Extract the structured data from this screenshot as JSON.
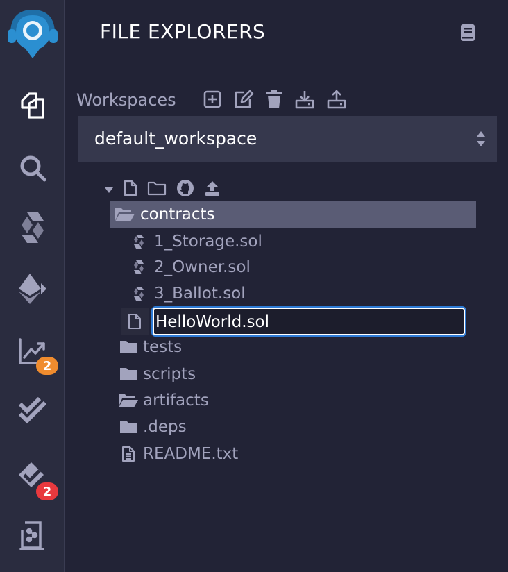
{
  "sidebar": {
    "icons": [
      "remix-logo-icon",
      "file-explorer-icon",
      "search-icon",
      "solidity-compiler-icon",
      "deploy-run-icon",
      "analysis-icon",
      "unit-testing-icon",
      "static-analysis-icon",
      "plugin-manager-icon"
    ],
    "analysis_badge": "2",
    "static_badge": "2",
    "colors": {
      "orange_badge": "#f08c2e",
      "red_badge": "#e8393e"
    }
  },
  "header": {
    "title": "FILE EXPLORERS"
  },
  "workspaces": {
    "label": "Workspaces",
    "selected": "default_workspace"
  },
  "tree": {
    "contracts_label": "contracts",
    "files": [
      "1_Storage.sol",
      "2_Owner.sol",
      "3_Ballot.sol"
    ],
    "editing_value": "HelloWorld.sol",
    "folders": [
      "tests",
      "scripts",
      "artifacts",
      ".deps"
    ],
    "readme": "README.txt"
  }
}
